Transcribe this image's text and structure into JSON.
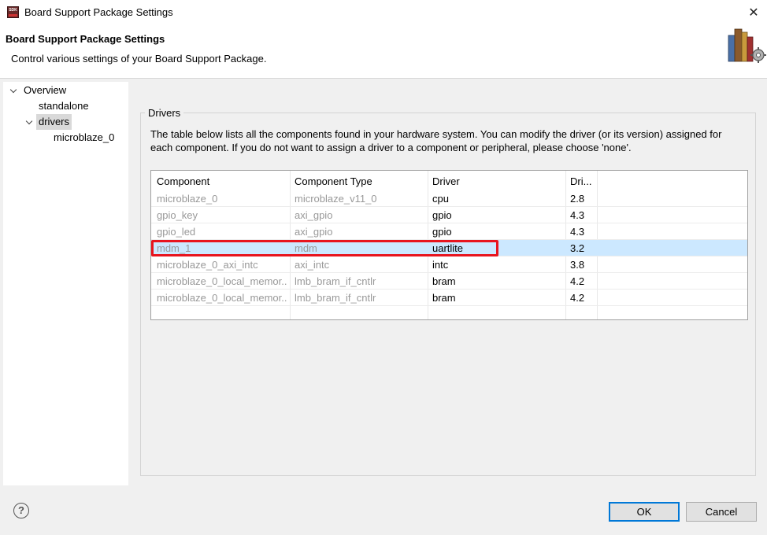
{
  "window": {
    "title": "Board Support Package Settings",
    "app_icon_label": "SDK",
    "close_glyph": "✕"
  },
  "header": {
    "title": "Board Support Package Settings",
    "description": "Control various settings of your Board Support Package."
  },
  "tree": {
    "items": [
      {
        "label": "Overview",
        "expanded": true
      },
      {
        "label": "standalone"
      },
      {
        "label": "drivers",
        "expanded": true,
        "selected": true
      },
      {
        "label": "microblaze_0"
      }
    ]
  },
  "drivers": {
    "group_label": "Drivers",
    "description": "The table below lists all the components found in your hardware system. You can modify the driver (or its version) assigned for each component. If you do not want to assign a driver to a component or peripheral, please choose 'none'.",
    "columns": [
      "Component",
      "Component Type",
      "Driver",
      "Dri..."
    ],
    "rows": [
      {
        "component": "microblaze_0",
        "type": "microblaze_v11_0",
        "driver": "cpu",
        "version": "2.8"
      },
      {
        "component": "gpio_key",
        "type": "axi_gpio",
        "driver": "gpio",
        "version": "4.3"
      },
      {
        "component": "gpio_led",
        "type": "axi_gpio",
        "driver": "gpio",
        "version": "4.3"
      },
      {
        "component": "mdm_1",
        "type": "mdm",
        "driver": "uartlite",
        "version": "3.2"
      },
      {
        "component": "microblaze_0_axi_intc",
        "type": "axi_intc",
        "driver": "intc",
        "version": "3.8"
      },
      {
        "component": "microblaze_0_local_memor...",
        "type": "lmb_bram_if_cntlr",
        "driver": "bram",
        "version": "4.2"
      },
      {
        "component": "microblaze_0_local_memor...",
        "type": "lmb_bram_if_cntlr",
        "driver": "bram",
        "version": "4.2"
      }
    ],
    "selected_row": 3
  },
  "footer": {
    "help_glyph": "?",
    "ok_label": "OK",
    "cancel_label": "Cancel"
  },
  "colors": {
    "selection": "#cce8ff",
    "highlight": "#e8141e",
    "accent": "#0078d7"
  }
}
